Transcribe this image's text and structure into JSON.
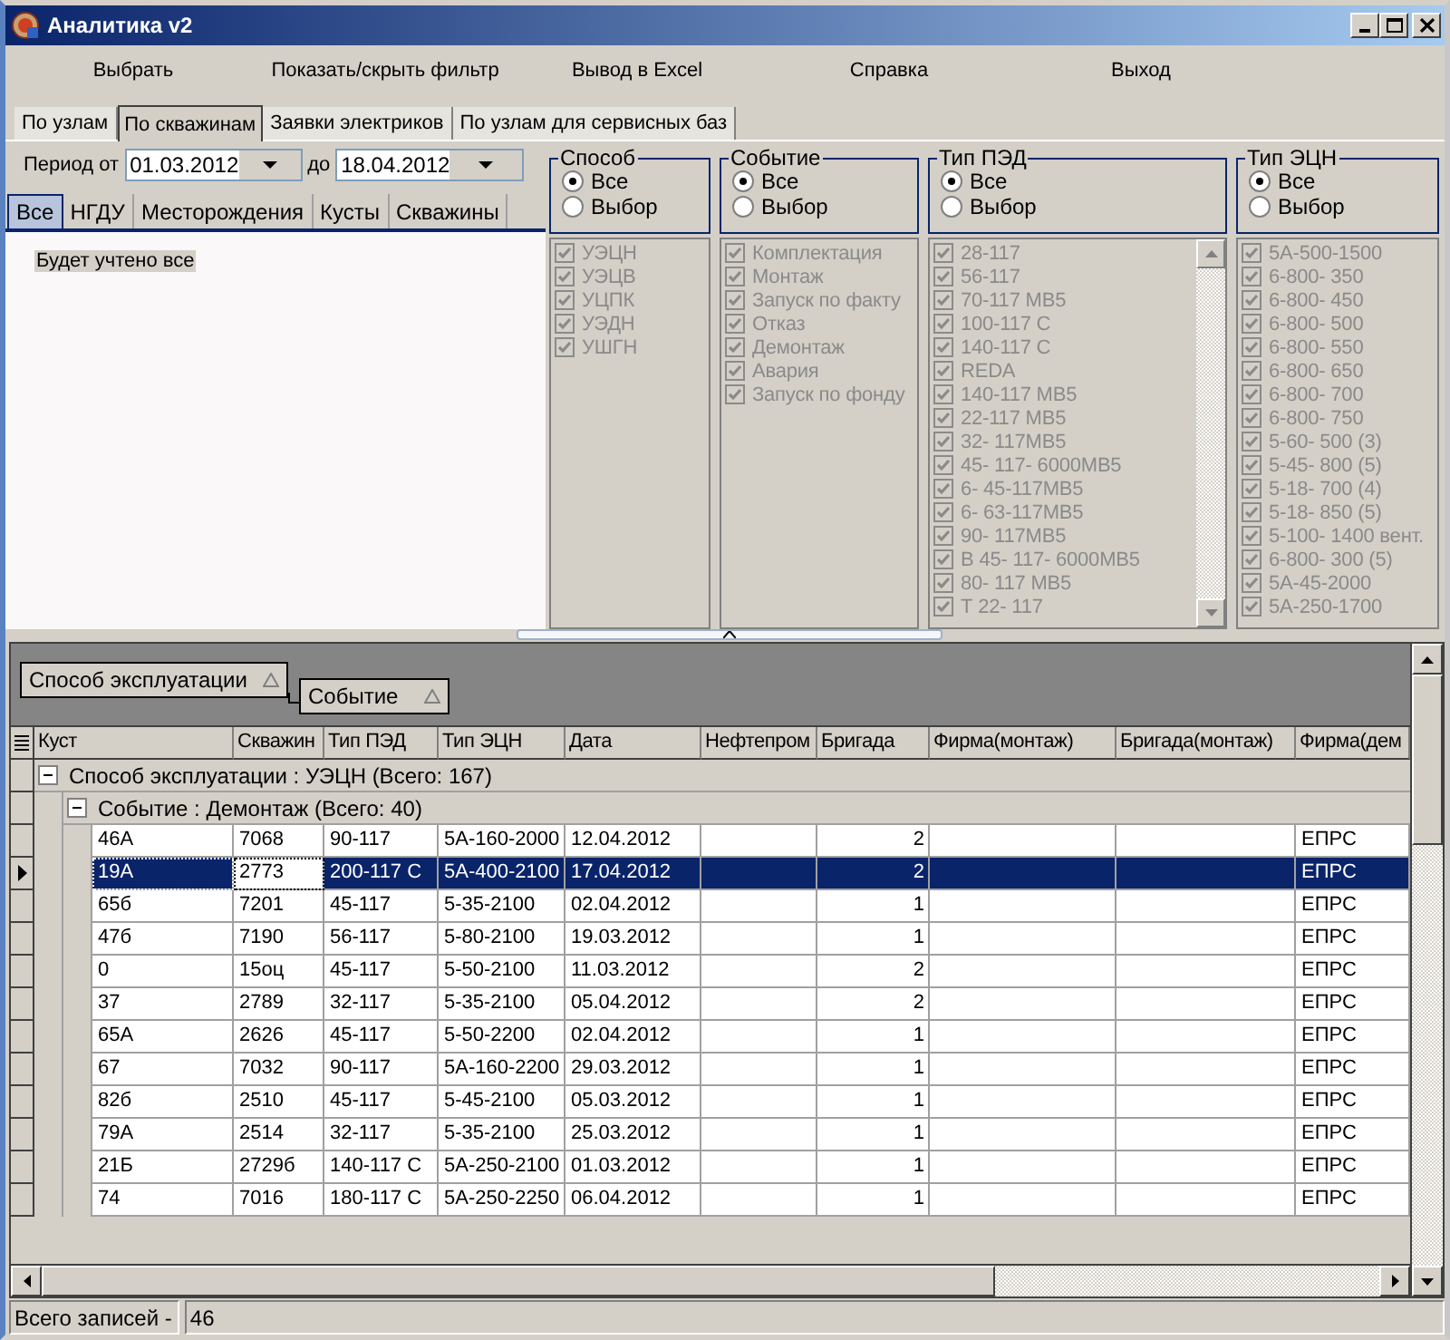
{
  "window": {
    "title": "Аналитика v2"
  },
  "menu": [
    "Выбрать",
    "Показать/скрыть фильтр",
    "Вывод в Excel",
    "Справка",
    "Выход"
  ],
  "tabs": [
    {
      "label": "По узлам",
      "selected": false
    },
    {
      "label": "По скважинам",
      "selected": true
    },
    {
      "label": "Заявки электриков",
      "selected": false
    },
    {
      "label": "По узлам для сервисных баз",
      "selected": false
    }
  ],
  "period": {
    "label_from": "Период от",
    "from": "01.03.2012",
    "label_to": "до",
    "to": "18.04.2012"
  },
  "scope_tabs": [
    {
      "label": "Все",
      "selected": true
    },
    {
      "label": "НГДУ",
      "selected": false
    },
    {
      "label": "Месторождения",
      "selected": false
    },
    {
      "label": "Кусты",
      "selected": false
    },
    {
      "label": "Скважины",
      "selected": false
    }
  ],
  "scope_note": "Будет учтено все",
  "filters": [
    {
      "title": "Способ",
      "disabled": true,
      "scrollbar": false,
      "options": [
        {
          "label": "Все",
          "selected": true
        },
        {
          "label": "Выбор",
          "selected": false
        }
      ],
      "items": [
        {
          "label": "УЭЦН",
          "checked": true
        },
        {
          "label": "УЭЦВ",
          "checked": true
        },
        {
          "label": "УЦПК",
          "checked": true
        },
        {
          "label": "УЭДН",
          "checked": true
        },
        {
          "label": "УШГН",
          "checked": true
        }
      ]
    },
    {
      "title": "Событие",
      "disabled": true,
      "scrollbar": false,
      "options": [
        {
          "label": "Все",
          "selected": true
        },
        {
          "label": "Выбор",
          "selected": false
        }
      ],
      "items": [
        {
          "label": "Комплектация",
          "checked": true
        },
        {
          "label": "Монтаж",
          "checked": true
        },
        {
          "label": "Запуск по факту",
          "checked": true
        },
        {
          "label": "Отказ",
          "checked": true
        },
        {
          "label": "Демонтаж",
          "checked": true
        },
        {
          "label": "Авария",
          "checked": true
        },
        {
          "label": "Запуск по фонду",
          "checked": true
        }
      ]
    },
    {
      "title": "Тип ПЭД",
      "disabled": true,
      "scrollbar": true,
      "options": [
        {
          "label": "Все",
          "selected": true
        },
        {
          "label": "Выбор",
          "selected": false
        }
      ],
      "items": [
        {
          "label": "28-117",
          "checked": true
        },
        {
          "label": "56-117",
          "checked": true
        },
        {
          "label": "70-117 МВ5",
          "checked": true
        },
        {
          "label": "100-117 С",
          "checked": true
        },
        {
          "label": "140-117 С",
          "checked": true
        },
        {
          "label": "REDA",
          "checked": true
        },
        {
          "label": "140-117 МВ5",
          "checked": true
        },
        {
          "label": "22-117 МВ5",
          "checked": true
        },
        {
          "label": "32- 117МВ5",
          "checked": true
        },
        {
          "label": "45- 117- 6000МВ5",
          "checked": true
        },
        {
          "label": "6- 45-117МВ5",
          "checked": true
        },
        {
          "label": "6- 63-117МВ5",
          "checked": true
        },
        {
          "label": "90- 117МВ5",
          "checked": true
        },
        {
          "label": "В 45- 117- 6000МВ5",
          "checked": true
        },
        {
          "label": "80- 117 МВ5",
          "checked": true
        },
        {
          "label": "Т 22- 117",
          "checked": true
        }
      ]
    },
    {
      "title": "Тип ЭЦН",
      "disabled": true,
      "scrollbar": false,
      "options": [
        {
          "label": "Все",
          "selected": true
        },
        {
          "label": "Выбор",
          "selected": false
        }
      ],
      "items": [
        {
          "label": "5А-500-1500",
          "checked": true
        },
        {
          "label": "6-800- 350",
          "checked": true
        },
        {
          "label": "6-800- 450",
          "checked": true
        },
        {
          "label": "6-800- 500",
          "checked": true
        },
        {
          "label": "6-800- 550",
          "checked": true
        },
        {
          "label": "6-800- 650",
          "checked": true
        },
        {
          "label": "6-800- 700",
          "checked": true
        },
        {
          "label": "6-800- 750",
          "checked": true
        },
        {
          "label": "5-60- 500 (3)",
          "checked": true
        },
        {
          "label": "5-45- 800 (5)",
          "checked": true
        },
        {
          "label": "5-18- 700 (4)",
          "checked": true
        },
        {
          "label": "5-18- 850 (5)",
          "checked": true
        },
        {
          "label": "5-100- 1400 вент.",
          "checked": true
        },
        {
          "label": "6-800- 300 (5)",
          "checked": true
        },
        {
          "label": "5А-45-2000",
          "checked": true
        },
        {
          "label": "5А-250-1700",
          "checked": true
        }
      ]
    }
  ],
  "grid": {
    "group_by": [
      "Способ эксплуатации",
      "Событие"
    ],
    "columns": [
      "Куст",
      "Скважин",
      "Тип ПЭД",
      "Тип ЭЦН",
      "Дата",
      "Нефтепром",
      "Бригада",
      "Фирма(монтаж)",
      "Бригада(монтаж)",
      "Фирма(дем"
    ],
    "groups": [
      {
        "label": "Способ эксплуатации : УЭЦН (Всего: 167)",
        "expanded": true,
        "children": [
          {
            "label": "Событие : Демонтаж (Всего: 40)",
            "expanded": true,
            "rows": [
              {
                "kust": "46А",
                "well": "7068",
                "ped": "90-117",
                "ecn": "5А-160-2000",
                "date": "12.04.2012",
                "brigade": "2",
                "firm_dem": "ЕПРС",
                "selected": false
              },
              {
                "kust": "19А",
                "well": "2773",
                "ped": "200-117 С",
                "ecn": "5А-400-2100",
                "date": "17.04.2012",
                "brigade": "2",
                "firm_dem": "ЕПРС",
                "selected": true
              },
              {
                "kust": "65б",
                "well": "7201",
                "ped": "45-117",
                "ecn": "5-35-2100",
                "date": "02.04.2012",
                "brigade": "1",
                "firm_dem": "ЕПРС",
                "selected": false
              },
              {
                "kust": "47б",
                "well": "7190",
                "ped": "56-117",
                "ecn": "5-80-2100",
                "date": "19.03.2012",
                "brigade": "1",
                "firm_dem": "ЕПРС",
                "selected": false
              },
              {
                "kust": "0",
                "well": "15оц",
                "ped": "45-117",
                "ecn": "5-50-2100",
                "date": "11.03.2012",
                "brigade": "2",
                "firm_dem": "ЕПРС",
                "selected": false
              },
              {
                "kust": "37",
                "well": "2789",
                "ped": "32-117",
                "ecn": "5-35-2100",
                "date": "05.04.2012",
                "brigade": "2",
                "firm_dem": "ЕПРС",
                "selected": false
              },
              {
                "kust": "65А",
                "well": "2626",
                "ped": "45-117",
                "ecn": "5-50-2200",
                "date": "02.04.2012",
                "brigade": "1",
                "firm_dem": "ЕПРС",
                "selected": false
              },
              {
                "kust": "67",
                "well": "7032",
                "ped": "90-117",
                "ecn": "5А-160-2200",
                "date": "29.03.2012",
                "brigade": "1",
                "firm_dem": "ЕПРС",
                "selected": false
              },
              {
                "kust": "82б",
                "well": "2510",
                "ped": "45-117",
                "ecn": "5-45-2100",
                "date": "05.03.2012",
                "brigade": "1",
                "firm_dem": "ЕПРС",
                "selected": false
              },
              {
                "kust": "79А",
                "well": "2514",
                "ped": "32-117",
                "ecn": "5-35-2100",
                "date": "25.03.2012",
                "brigade": "1",
                "firm_dem": "ЕПРС",
                "selected": false
              },
              {
                "kust": "21Б",
                "well": "2729б",
                "ped": "140-117 С",
                "ecn": "5А-250-2100",
                "date": "01.03.2012",
                "brigade": "1",
                "firm_dem": "ЕПРС",
                "selected": false
              },
              {
                "kust": "74",
                "well": "7016",
                "ped": "180-117 С",
                "ecn": "5А-250-2250",
                "date": "06.04.2012",
                "brigade": "1",
                "firm_dem": "ЕПРС",
                "selected": false
              }
            ]
          }
        ]
      }
    ]
  },
  "status": {
    "label": "Всего записей -",
    "value": "46"
  }
}
